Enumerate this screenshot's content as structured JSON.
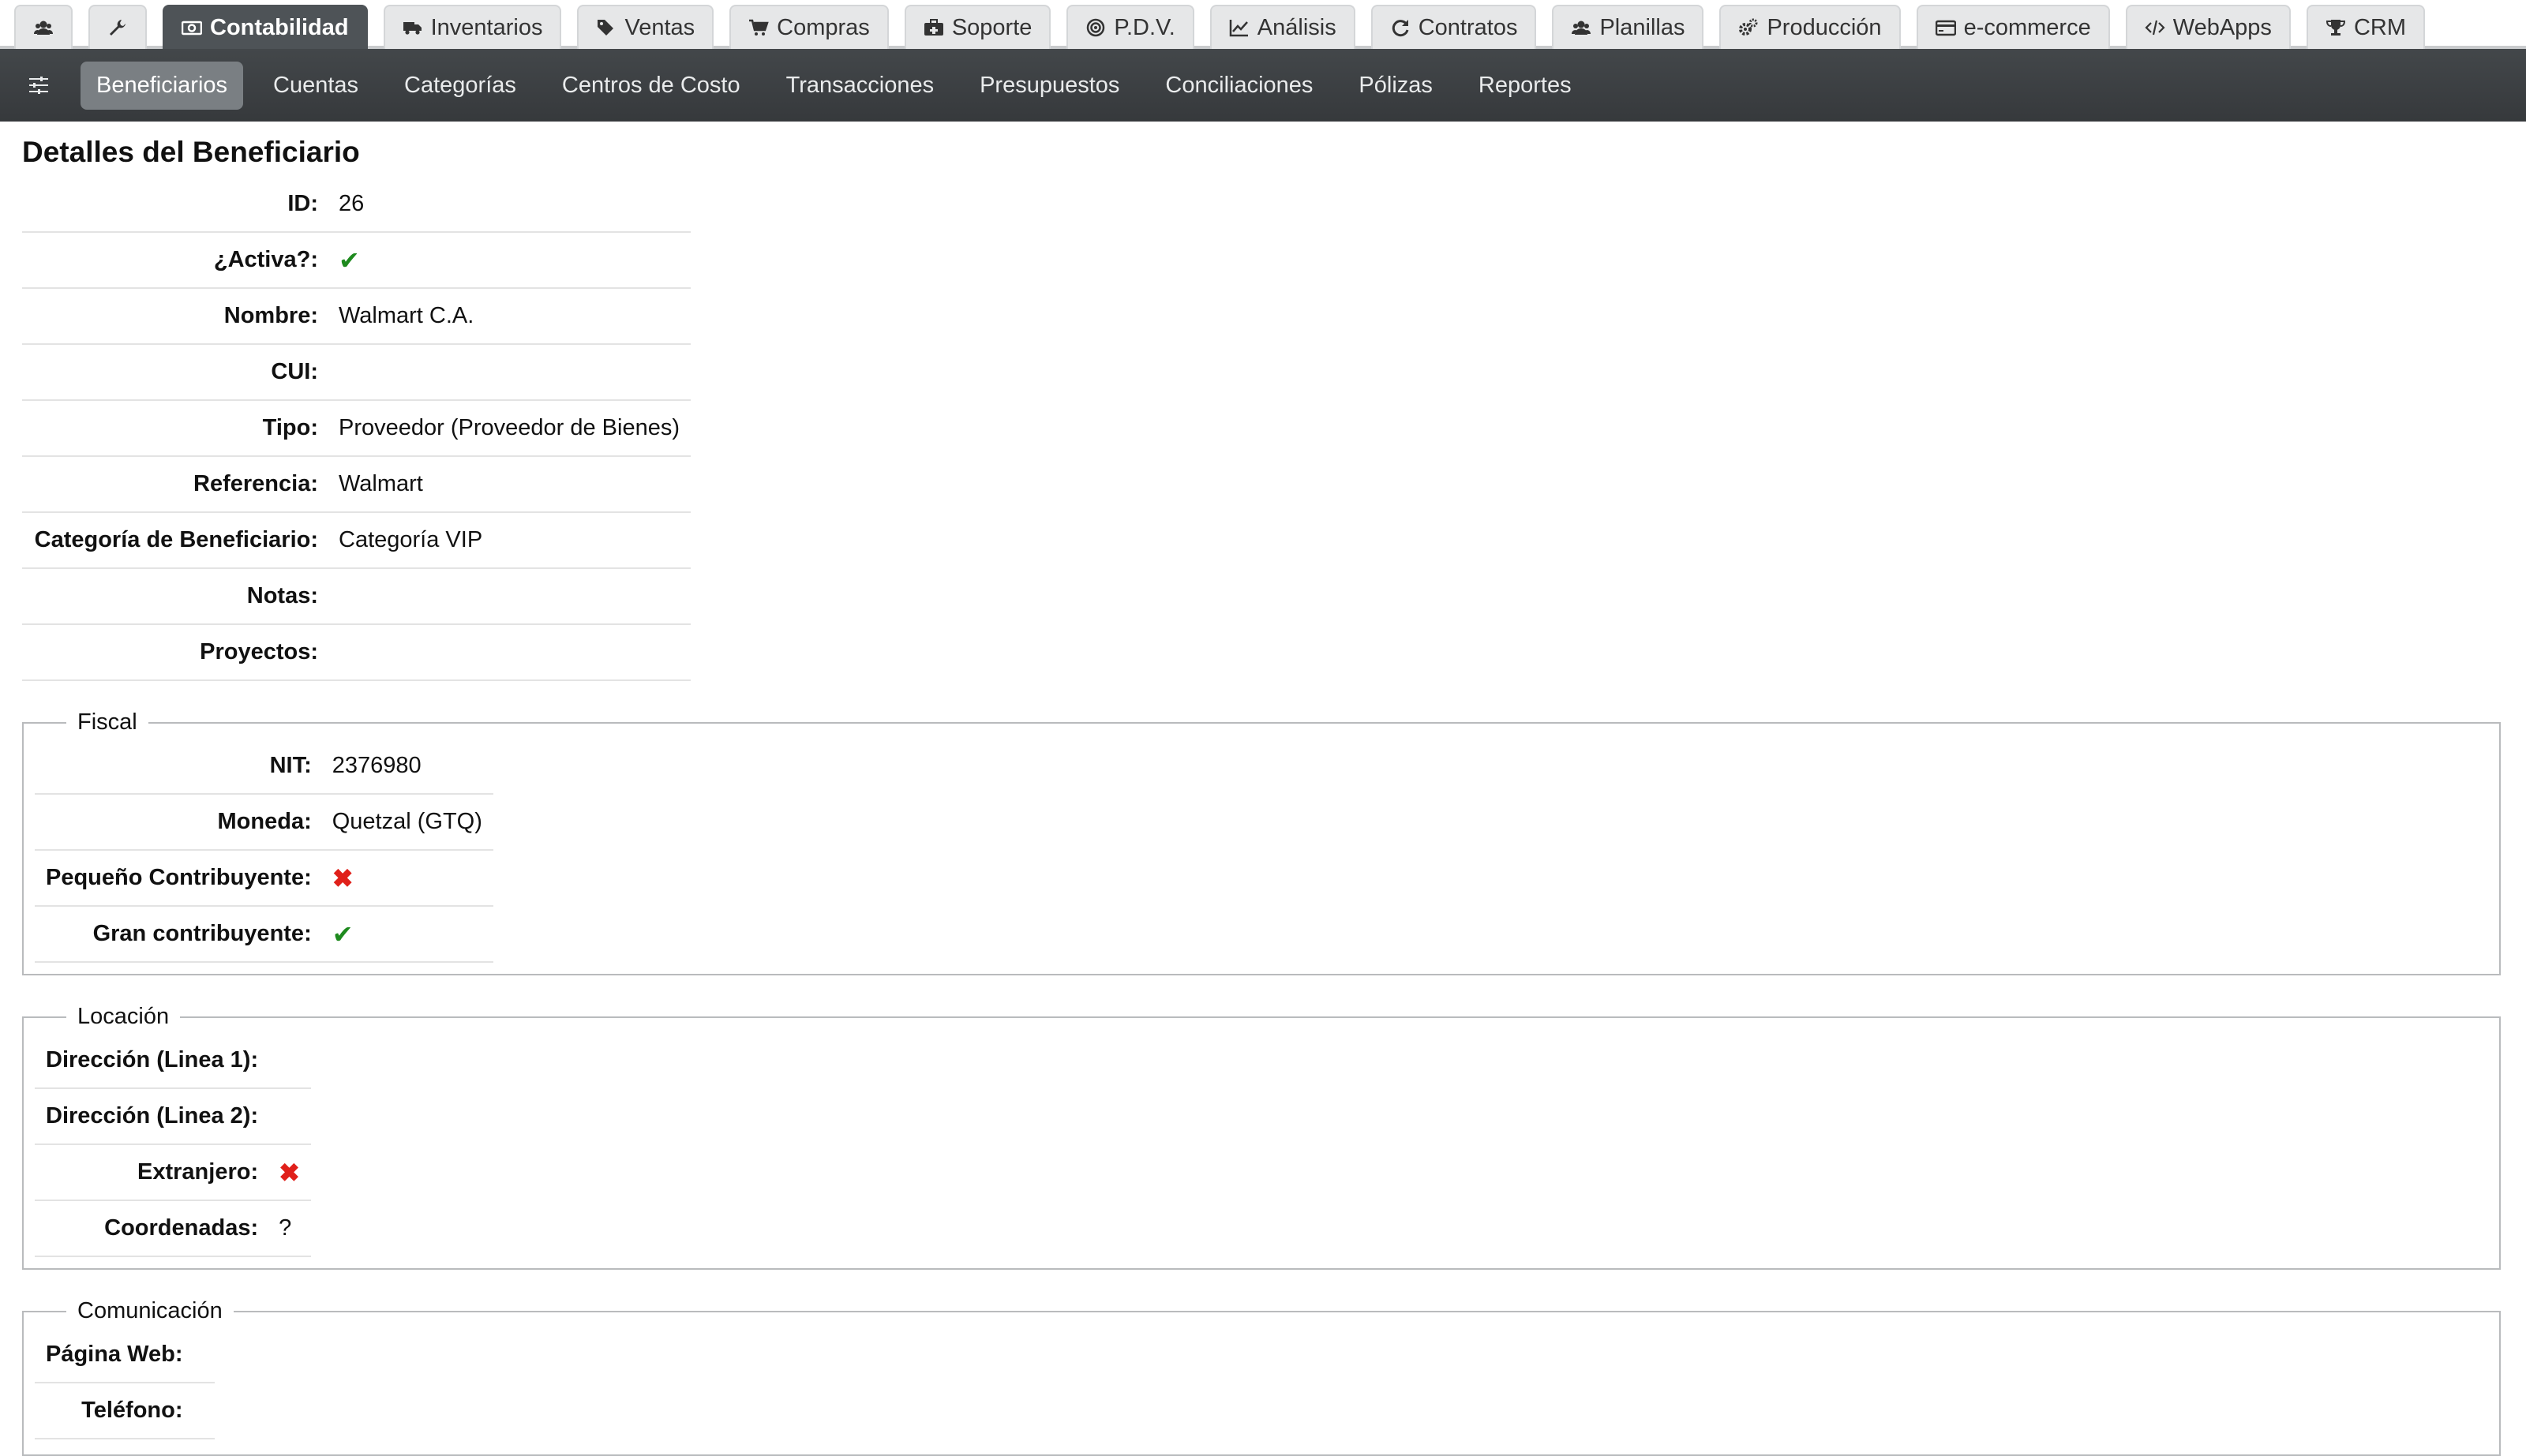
{
  "top_tabs": [
    {
      "icon": "users-icon",
      "label": ""
    },
    {
      "icon": "wrench-icon",
      "label": ""
    },
    {
      "icon": "money-icon",
      "label": "Contabilidad"
    },
    {
      "icon": "truck-icon",
      "label": "Inventarios"
    },
    {
      "icon": "tags-icon",
      "label": "Ventas"
    },
    {
      "icon": "cart-icon",
      "label": "Compras"
    },
    {
      "icon": "medkit-icon",
      "label": "Soporte"
    },
    {
      "icon": "target-icon",
      "label": "P.D.V."
    },
    {
      "icon": "line-chart-icon",
      "label": "Análisis"
    },
    {
      "icon": "refresh-icon",
      "label": "Contratos"
    },
    {
      "icon": "users-icon",
      "label": "Planillas"
    },
    {
      "icon": "cogs-icon",
      "label": "Producción"
    },
    {
      "icon": "credit-card-icon",
      "label": "e-commerce"
    },
    {
      "icon": "code-icon",
      "label": "WebApps"
    },
    {
      "icon": "trophy-icon",
      "label": "CRM"
    }
  ],
  "active_top_tab": "Contabilidad",
  "subnav": {
    "toggle_icon": "sliders-icon",
    "items": [
      "Beneficiarios",
      "Cuentas",
      "Categorías",
      "Centros de Costo",
      "Transacciones",
      "Presupuestos",
      "Conciliaciones",
      "Pólizas",
      "Reportes"
    ],
    "active": "Beneficiarios"
  },
  "page_title": "Detalles del Beneficiario",
  "details": {
    "id_label": "ID:",
    "id_value": "26",
    "active_label": "¿Activa?:",
    "active_value": "check",
    "name_label": "Nombre:",
    "name_value": "Walmart C.A.",
    "cui_label": "CUI:",
    "cui_value": "",
    "type_label": "Tipo:",
    "type_value": "Proveedor (Proveedor de Bienes)",
    "ref_label": "Referencia:",
    "ref_value": "Walmart",
    "category_label": "Categoría de Beneficiario:",
    "category_value": "Categoría VIP",
    "notes_label": "Notas:",
    "notes_value": "",
    "projects_label": "Proyectos:",
    "projects_value": ""
  },
  "fiscal": {
    "legend": "Fiscal",
    "nit_label": "NIT:",
    "nit_value": "2376980",
    "currency_label": "Moneda:",
    "currency_value": "Quetzal (GTQ)",
    "small_taxpayer_label": "Pequeño Contribuyente:",
    "small_taxpayer_value": "cross",
    "large_taxpayer_label": "Gran contribuyente:",
    "large_taxpayer_value": "check"
  },
  "location": {
    "legend": "Locación",
    "address1_label": "Dirección (Linea 1):",
    "address1_value": "",
    "address2_label": "Dirección (Linea 2):",
    "address2_value": "",
    "foreign_label": "Extranjero:",
    "foreign_value": "cross",
    "coords_label": "Coordenadas:",
    "coords_value": "?"
  },
  "communication": {
    "legend": "Comunicación",
    "web_label": "Página Web:",
    "web_value": "",
    "phone_label": "Teléfono:"
  },
  "colors": {
    "active_tab": "#4e5357",
    "subnav_bg": "#3d4144",
    "check": "#1e8a1e",
    "cross": "#e0201a"
  },
  "symbols": {
    "check": "✔",
    "cross": "✖"
  }
}
